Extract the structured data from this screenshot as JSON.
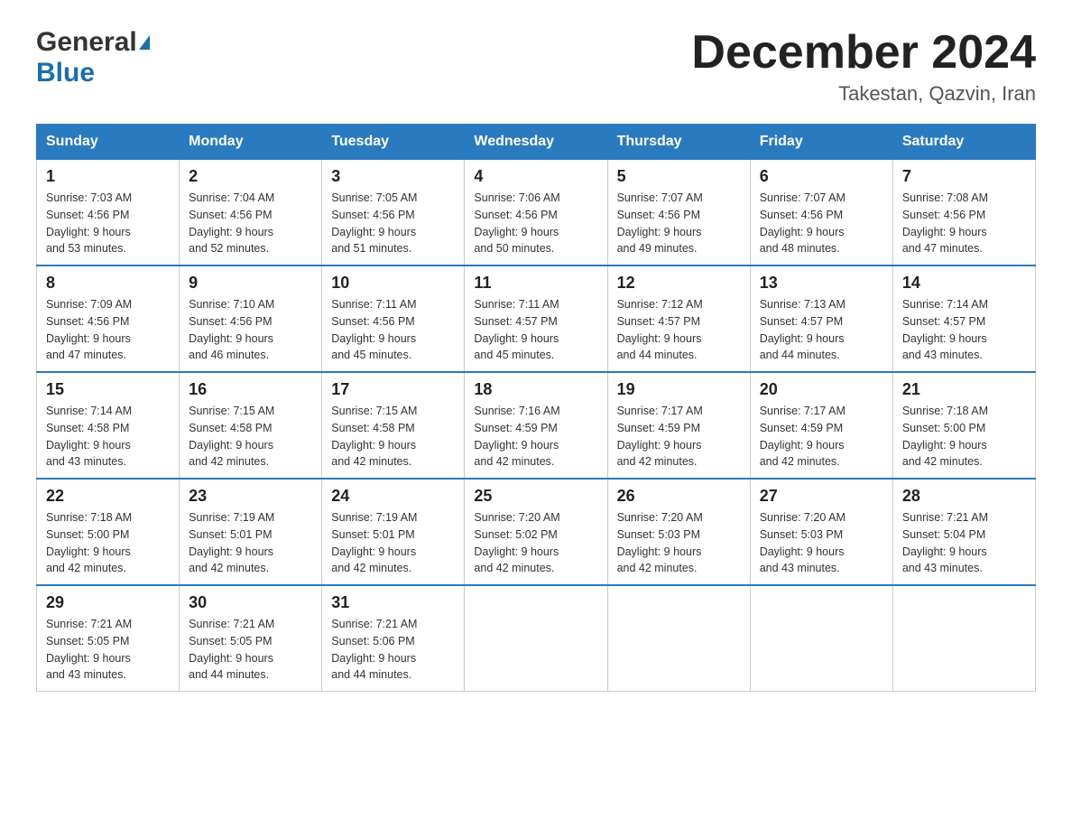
{
  "header": {
    "logo_general": "General",
    "logo_blue": "Blue",
    "month_title": "December 2024",
    "location": "Takestan, Qazvin, Iran"
  },
  "columns": [
    "Sunday",
    "Monday",
    "Tuesday",
    "Wednesday",
    "Thursday",
    "Friday",
    "Saturday"
  ],
  "weeks": [
    [
      {
        "day": "1",
        "sunrise": "7:03 AM",
        "sunset": "4:56 PM",
        "daylight": "9 hours and 53 minutes."
      },
      {
        "day": "2",
        "sunrise": "7:04 AM",
        "sunset": "4:56 PM",
        "daylight": "9 hours and 52 minutes."
      },
      {
        "day": "3",
        "sunrise": "7:05 AM",
        "sunset": "4:56 PM",
        "daylight": "9 hours and 51 minutes."
      },
      {
        "day": "4",
        "sunrise": "7:06 AM",
        "sunset": "4:56 PM",
        "daylight": "9 hours and 50 minutes."
      },
      {
        "day": "5",
        "sunrise": "7:07 AM",
        "sunset": "4:56 PM",
        "daylight": "9 hours and 49 minutes."
      },
      {
        "day": "6",
        "sunrise": "7:07 AM",
        "sunset": "4:56 PM",
        "daylight": "9 hours and 48 minutes."
      },
      {
        "day": "7",
        "sunrise": "7:08 AM",
        "sunset": "4:56 PM",
        "daylight": "9 hours and 47 minutes."
      }
    ],
    [
      {
        "day": "8",
        "sunrise": "7:09 AM",
        "sunset": "4:56 PM",
        "daylight": "9 hours and 47 minutes."
      },
      {
        "day": "9",
        "sunrise": "7:10 AM",
        "sunset": "4:56 PM",
        "daylight": "9 hours and 46 minutes."
      },
      {
        "day": "10",
        "sunrise": "7:11 AM",
        "sunset": "4:56 PM",
        "daylight": "9 hours and 45 minutes."
      },
      {
        "day": "11",
        "sunrise": "7:11 AM",
        "sunset": "4:57 PM",
        "daylight": "9 hours and 45 minutes."
      },
      {
        "day": "12",
        "sunrise": "7:12 AM",
        "sunset": "4:57 PM",
        "daylight": "9 hours and 44 minutes."
      },
      {
        "day": "13",
        "sunrise": "7:13 AM",
        "sunset": "4:57 PM",
        "daylight": "9 hours and 44 minutes."
      },
      {
        "day": "14",
        "sunrise": "7:14 AM",
        "sunset": "4:57 PM",
        "daylight": "9 hours and 43 minutes."
      }
    ],
    [
      {
        "day": "15",
        "sunrise": "7:14 AM",
        "sunset": "4:58 PM",
        "daylight": "9 hours and 43 minutes."
      },
      {
        "day": "16",
        "sunrise": "7:15 AM",
        "sunset": "4:58 PM",
        "daylight": "9 hours and 42 minutes."
      },
      {
        "day": "17",
        "sunrise": "7:15 AM",
        "sunset": "4:58 PM",
        "daylight": "9 hours and 42 minutes."
      },
      {
        "day": "18",
        "sunrise": "7:16 AM",
        "sunset": "4:59 PM",
        "daylight": "9 hours and 42 minutes."
      },
      {
        "day": "19",
        "sunrise": "7:17 AM",
        "sunset": "4:59 PM",
        "daylight": "9 hours and 42 minutes."
      },
      {
        "day": "20",
        "sunrise": "7:17 AM",
        "sunset": "4:59 PM",
        "daylight": "9 hours and 42 minutes."
      },
      {
        "day": "21",
        "sunrise": "7:18 AM",
        "sunset": "5:00 PM",
        "daylight": "9 hours and 42 minutes."
      }
    ],
    [
      {
        "day": "22",
        "sunrise": "7:18 AM",
        "sunset": "5:00 PM",
        "daylight": "9 hours and 42 minutes."
      },
      {
        "day": "23",
        "sunrise": "7:19 AM",
        "sunset": "5:01 PM",
        "daylight": "9 hours and 42 minutes."
      },
      {
        "day": "24",
        "sunrise": "7:19 AM",
        "sunset": "5:01 PM",
        "daylight": "9 hours and 42 minutes."
      },
      {
        "day": "25",
        "sunrise": "7:20 AM",
        "sunset": "5:02 PM",
        "daylight": "9 hours and 42 minutes."
      },
      {
        "day": "26",
        "sunrise": "7:20 AM",
        "sunset": "5:03 PM",
        "daylight": "9 hours and 42 minutes."
      },
      {
        "day": "27",
        "sunrise": "7:20 AM",
        "sunset": "5:03 PM",
        "daylight": "9 hours and 43 minutes."
      },
      {
        "day": "28",
        "sunrise": "7:21 AM",
        "sunset": "5:04 PM",
        "daylight": "9 hours and 43 minutes."
      }
    ],
    [
      {
        "day": "29",
        "sunrise": "7:21 AM",
        "sunset": "5:05 PM",
        "daylight": "9 hours and 43 minutes."
      },
      {
        "day": "30",
        "sunrise": "7:21 AM",
        "sunset": "5:05 PM",
        "daylight": "9 hours and 44 minutes."
      },
      {
        "day": "31",
        "sunrise": "7:21 AM",
        "sunset": "5:06 PM",
        "daylight": "9 hours and 44 minutes."
      },
      null,
      null,
      null,
      null
    ]
  ],
  "labels": {
    "sunrise": "Sunrise:",
    "sunset": "Sunset:",
    "daylight": "Daylight:"
  }
}
